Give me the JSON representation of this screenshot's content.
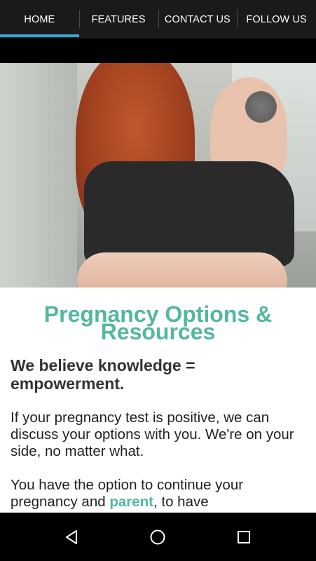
{
  "tabs": [
    {
      "label": "HOME",
      "active": true
    },
    {
      "label": "FEATURES",
      "active": false
    },
    {
      "label": "CONTACT US",
      "active": false
    },
    {
      "label": "FOLLOW US",
      "active": false
    }
  ],
  "colors": {
    "accent_tab_indicator": "#35a7d9",
    "heading_teal": "#54b7a1",
    "text_dark": "#333333"
  },
  "hero": {
    "image_icon": "hero-photo"
  },
  "content": {
    "title": "Pregnancy Options & Resources",
    "subheading": "We believe knowledge = empowerment.",
    "paragraph_1": "If your pregnancy test is positive, we can discuss your options with you. We're on your side, no matter what.",
    "paragraph_2_before": "You have the option to continue your pregnancy and ",
    "paragraph_2_link": "parent",
    "paragraph_2_after": ", to have"
  },
  "navbar": {
    "back_icon": "back-triangle-icon",
    "home_icon": "home-circle-icon",
    "recent_icon": "recent-apps-square-icon"
  }
}
